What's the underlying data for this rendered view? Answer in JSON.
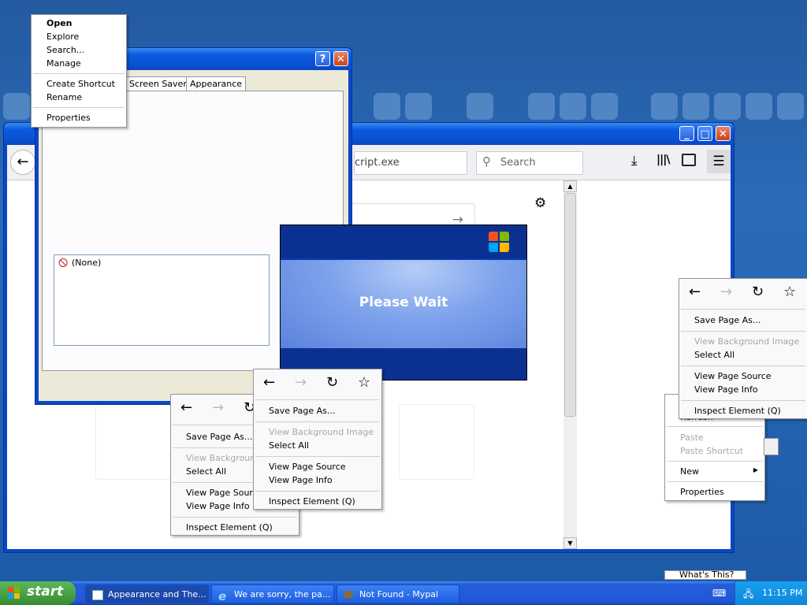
{
  "desktop_menu": {
    "items": [
      "Open",
      "Explore",
      "Search...",
      "Manage",
      "Create Shortcut",
      "Rename",
      "Properties"
    ]
  },
  "display_props": {
    "tabs": [
      "Screen Saver",
      "Appearance"
    ],
    "list_item": "(None)"
  },
  "browser": {
    "address_fragment": "cript.exe",
    "search_placeholder": "Search"
  },
  "please_wait": {
    "text": "Please Wait"
  },
  "fx_menu": {
    "save": "Save Page As...",
    "view_bg": "View Background Image",
    "view_bg_short": "View Background",
    "select_all": "Select All",
    "view_source": "View Page Source",
    "view_info": "View Page Info",
    "inspect": "Inspect Element (Q)"
  },
  "explorer_menu": {
    "refresh": "Refresh",
    "paste": "Paste",
    "paste_shortcut": "Paste Shortcut",
    "new": "New",
    "properties": "Properties"
  },
  "bottom_fragment": "What's This?",
  "taskbar": {
    "start": "start",
    "tasks": [
      "Appearance and The...",
      "We are sorry, the pa...",
      "Not Found - Mypal"
    ],
    "clock": "11:15 PM"
  }
}
